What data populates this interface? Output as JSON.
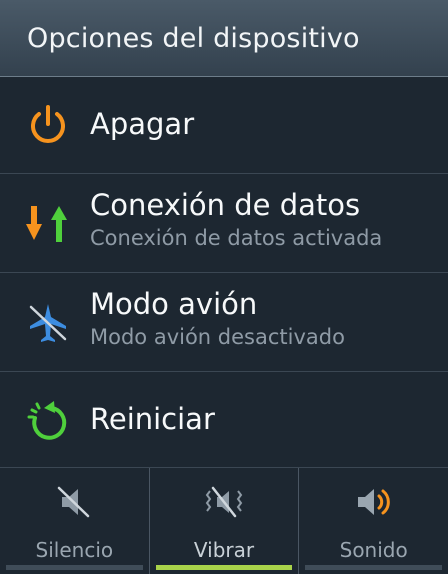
{
  "header": {
    "title": "Opciones del dispositivo"
  },
  "items": [
    {
      "label": "Apagar",
      "icon": "power-icon",
      "color": "#f6931e"
    },
    {
      "label": "Conexión de datos",
      "sub": "Conexión de datos activada",
      "icon": "data-transfer-icon"
    },
    {
      "label": "Modo avión",
      "sub": "Modo avión desactivado",
      "icon": "airplane-off-icon",
      "color": "#3d8de0"
    },
    {
      "label": "Reiniciar",
      "icon": "restart-icon",
      "color": "#4fd03c"
    }
  ],
  "sound_modes": [
    {
      "label": "Silencio",
      "icon": "mute-icon",
      "active": false
    },
    {
      "label": "Vibrar",
      "icon": "vibrate-icon",
      "active": true
    },
    {
      "label": "Sonido",
      "icon": "speaker-icon",
      "active": false
    }
  ],
  "colors": {
    "background": "#1d2731",
    "accent_active": "#a9d34a",
    "power": "#f6931e",
    "airplane": "#3d8de0",
    "restart": "#4fd03c"
  }
}
